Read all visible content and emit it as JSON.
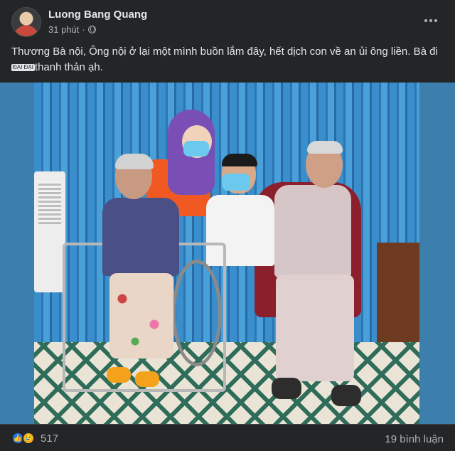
{
  "post": {
    "author": "Luong Bang Quang",
    "time": "31 phút",
    "visibility_icon": "globe-icon",
    "caption_part1": "Thương Bà nội, Ông nội ở lại một mình buồn lắm đây, hết dịch con về an ủi ông liền. Bà đi ",
    "caption_sticker": "ĐẠI ĐẠI",
    "caption_part2": "thanh thản ạh."
  },
  "footer": {
    "reaction_icons": [
      "like-icon",
      "sad-icon"
    ],
    "reaction_count": "517",
    "comment_count": "19 bình luận"
  },
  "colors": {
    "background": "#242526",
    "text": "#e4e6eb",
    "secondary_text": "#b0b3b8",
    "like_blue": "#2078f4",
    "sad_yellow": "#f7b125",
    "photo_border": "#3c7fad"
  }
}
